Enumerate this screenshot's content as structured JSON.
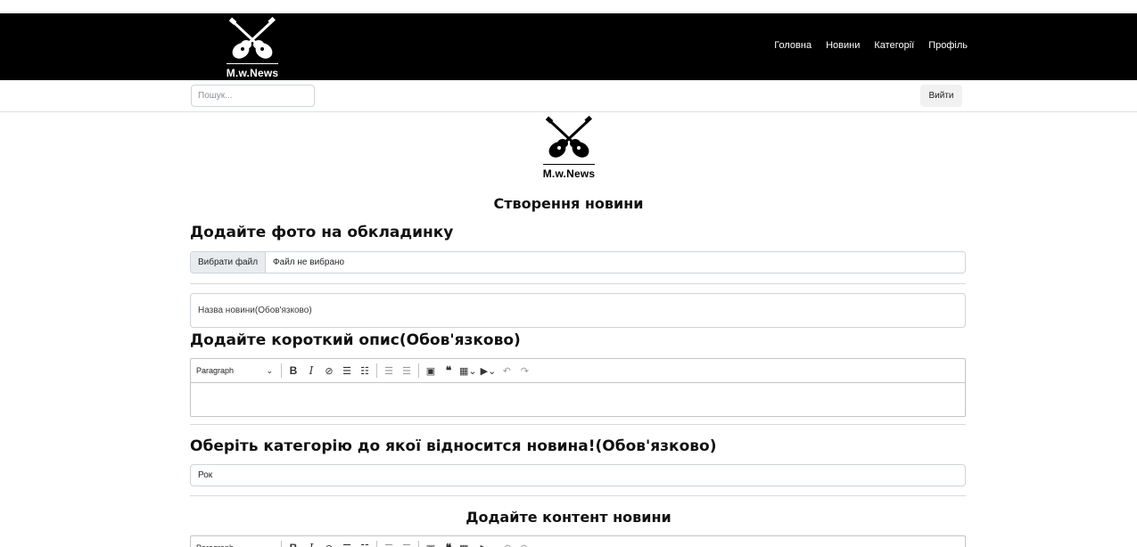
{
  "header": {
    "logo_text": "M.w.News",
    "nav": [
      {
        "label": "Головна"
      },
      {
        "label": "Новини"
      },
      {
        "label": "Категорії"
      },
      {
        "label": "Профіль"
      }
    ]
  },
  "subbar": {
    "search_placeholder": "Пошук...",
    "logout_label": "Вийти"
  },
  "main": {
    "logo_text": "M.w.News",
    "page_title": "Створення новини",
    "cover_heading": "Додайте фото на обкладинку",
    "file_button_label": "Вибрати файл",
    "file_status": "Файл не вибрано",
    "title_placeholder": "Назва новини(Обов'язково)",
    "description_heading": "Додайте короткий опис(Обов'язково)",
    "category_heading": "Оберіть категорію до якої відносится новина!(Обов'язково)",
    "category_value": "Рок",
    "content_heading": "Додайте контент новини"
  },
  "editor": {
    "paragraph_label": "Paragraph",
    "icons": [
      "chevron-down-icon",
      "bold-icon",
      "italic-icon",
      "link-icon",
      "bulleted-list-icon",
      "numbered-list-icon",
      "outdent-icon",
      "indent-icon",
      "image-icon",
      "quote-icon",
      "table-icon",
      "media-icon",
      "undo-icon",
      "redo-icon"
    ]
  }
}
